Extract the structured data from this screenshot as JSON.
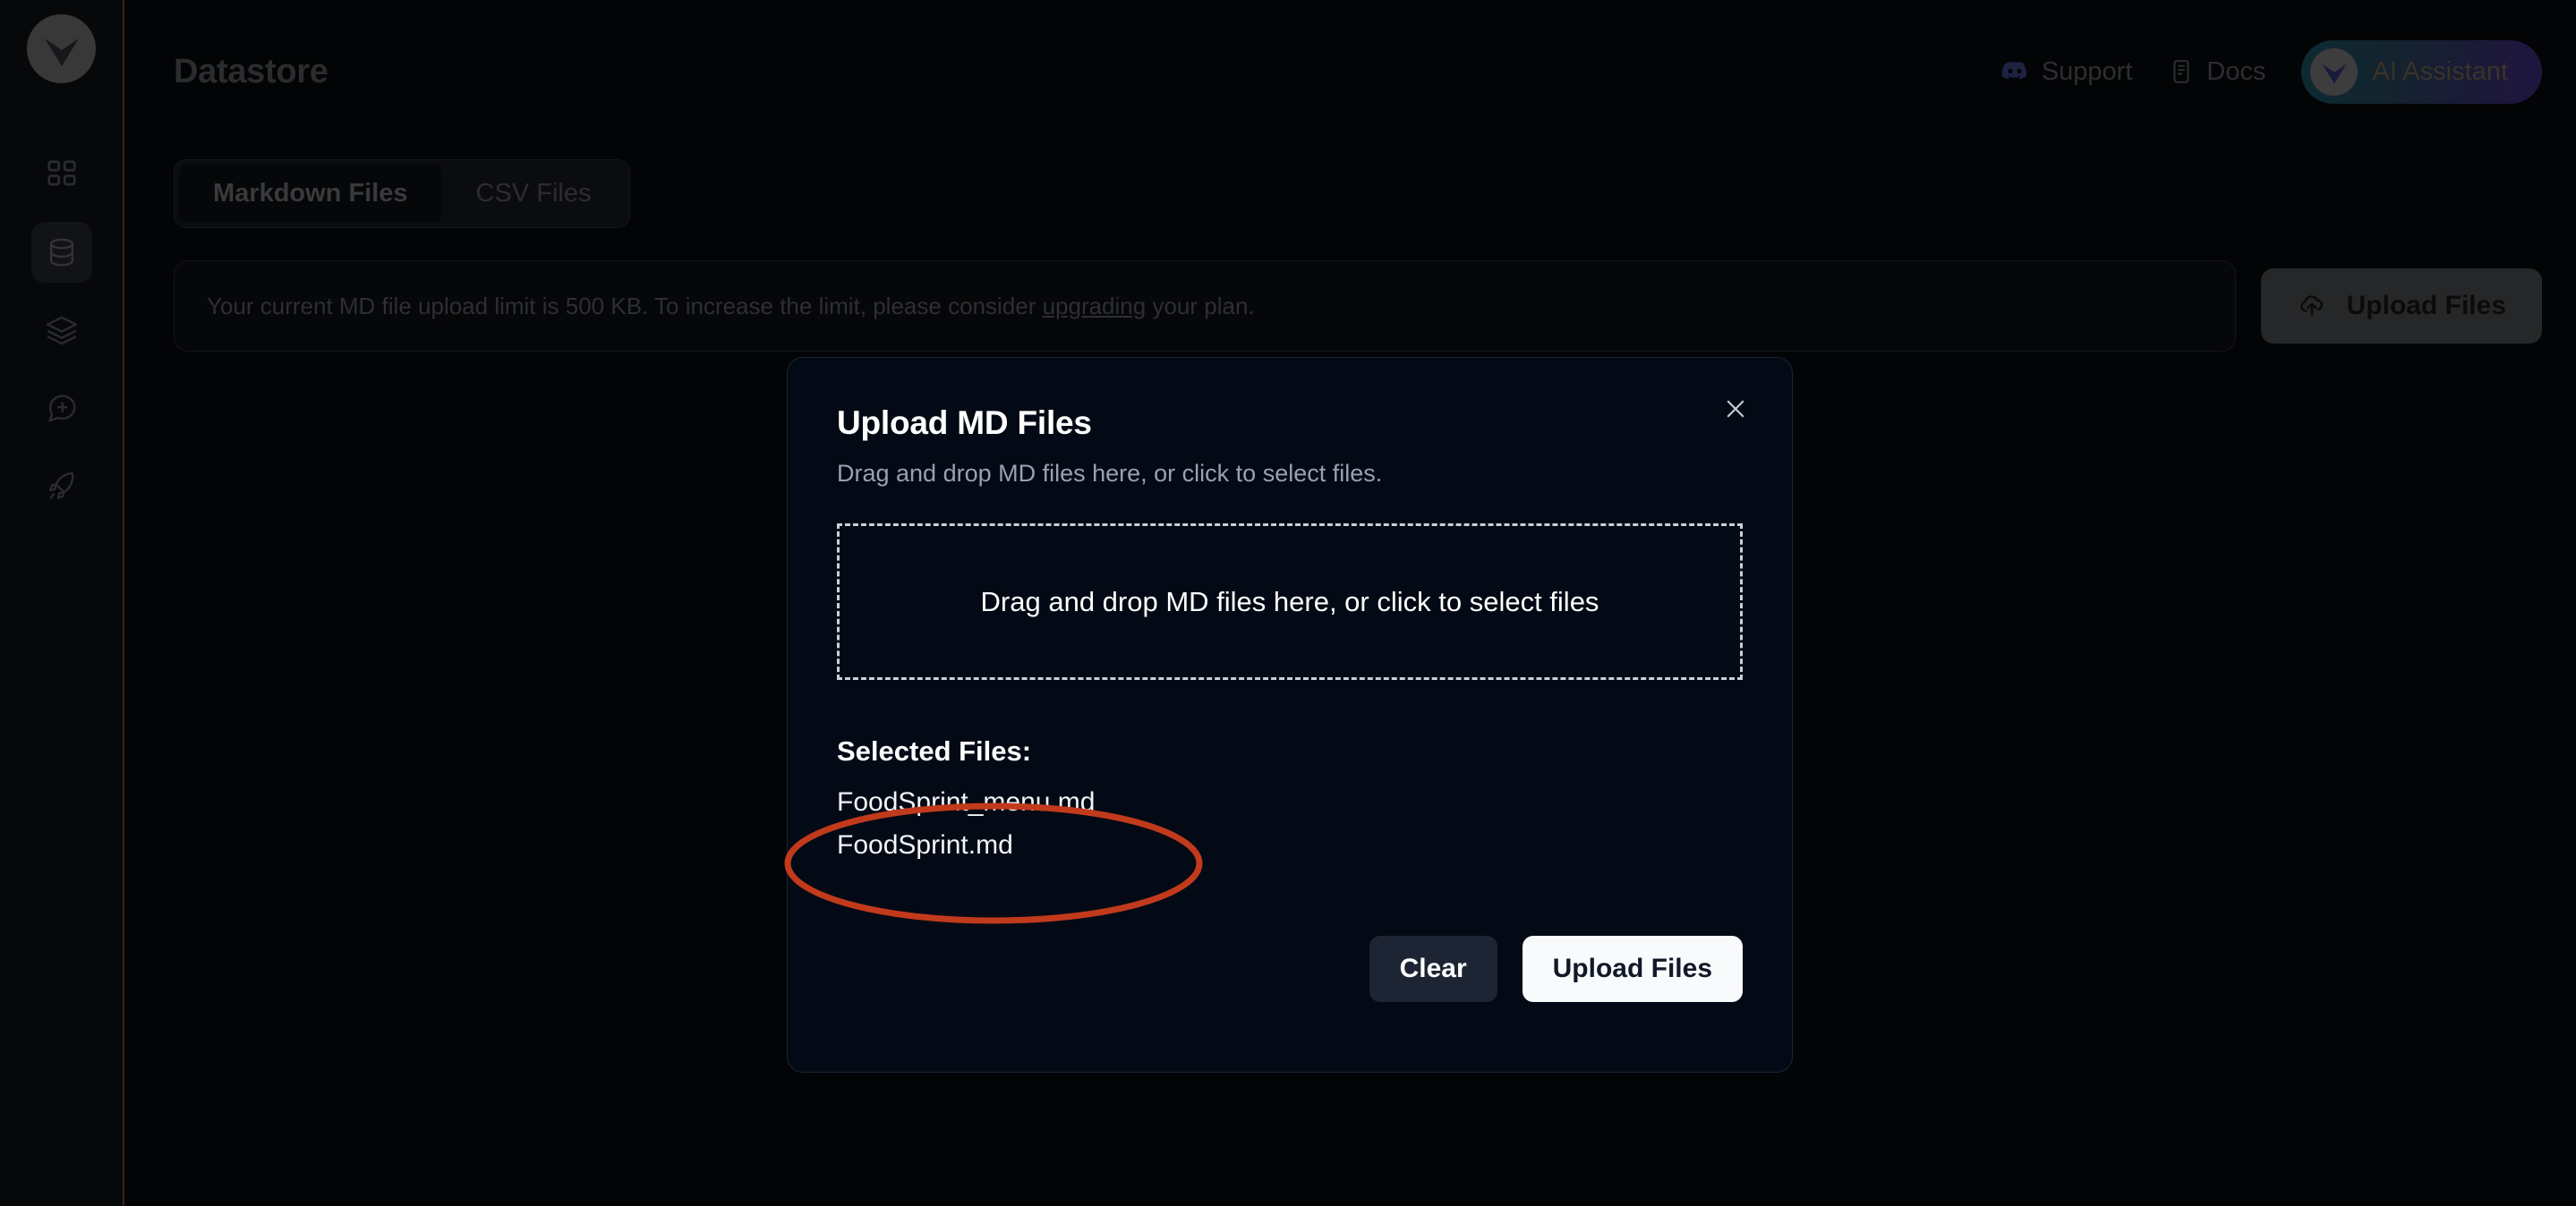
{
  "sidebar": {
    "logo_icon": "vector-logo-icon",
    "items": [
      {
        "name": "dashboard",
        "icon": "grid-icon",
        "active": false
      },
      {
        "name": "datastore",
        "icon": "database-icon",
        "active": true
      },
      {
        "name": "layers",
        "icon": "layers-icon",
        "active": false
      },
      {
        "name": "new-chat",
        "icon": "chat-plus-icon",
        "active": false
      },
      {
        "name": "deploy",
        "icon": "rocket-icon",
        "active": false
      }
    ]
  },
  "header": {
    "title": "Datastore",
    "support_label": "Support",
    "support_icon": "discord-icon",
    "docs_label": "Docs",
    "docs_icon": "document-icon",
    "ai_assistant_label": "AI Assistant",
    "ai_assistant_icon": "vector-logo-icon",
    "ai_pill_gradient_start": "#0d2b30",
    "ai_pill_gradient_end": "#201541"
  },
  "main": {
    "tabs": [
      {
        "label": "Markdown Files",
        "active": true
      },
      {
        "label": "CSV Files",
        "active": false
      }
    ],
    "notice_prefix": "Your current MD file upload limit is 500 KB. To increase the limit, please consider ",
    "notice_link": "upgrading",
    "notice_suffix": " your plan.",
    "upload_button_label": "Upload Files",
    "upload_button_icon": "cloud-upload-icon"
  },
  "modal": {
    "title": "Upload MD Files",
    "subtitle": "Drag and drop MD files here, or click to select files.",
    "dropzone_text": "Drag and drop MD files here, or click to select files",
    "selected_files_label": "Selected Files:",
    "files": [
      "FoodSprint_menu.md",
      "FoodSprint.md"
    ],
    "clear_label": "Clear",
    "upload_label": "Upload Files",
    "close_icon": "close-icon"
  },
  "annotation": {
    "shape": "ellipse",
    "color": "#c23a1c",
    "targets": [
      "FoodSprint_menu.md",
      "FoodSprint.md"
    ]
  }
}
